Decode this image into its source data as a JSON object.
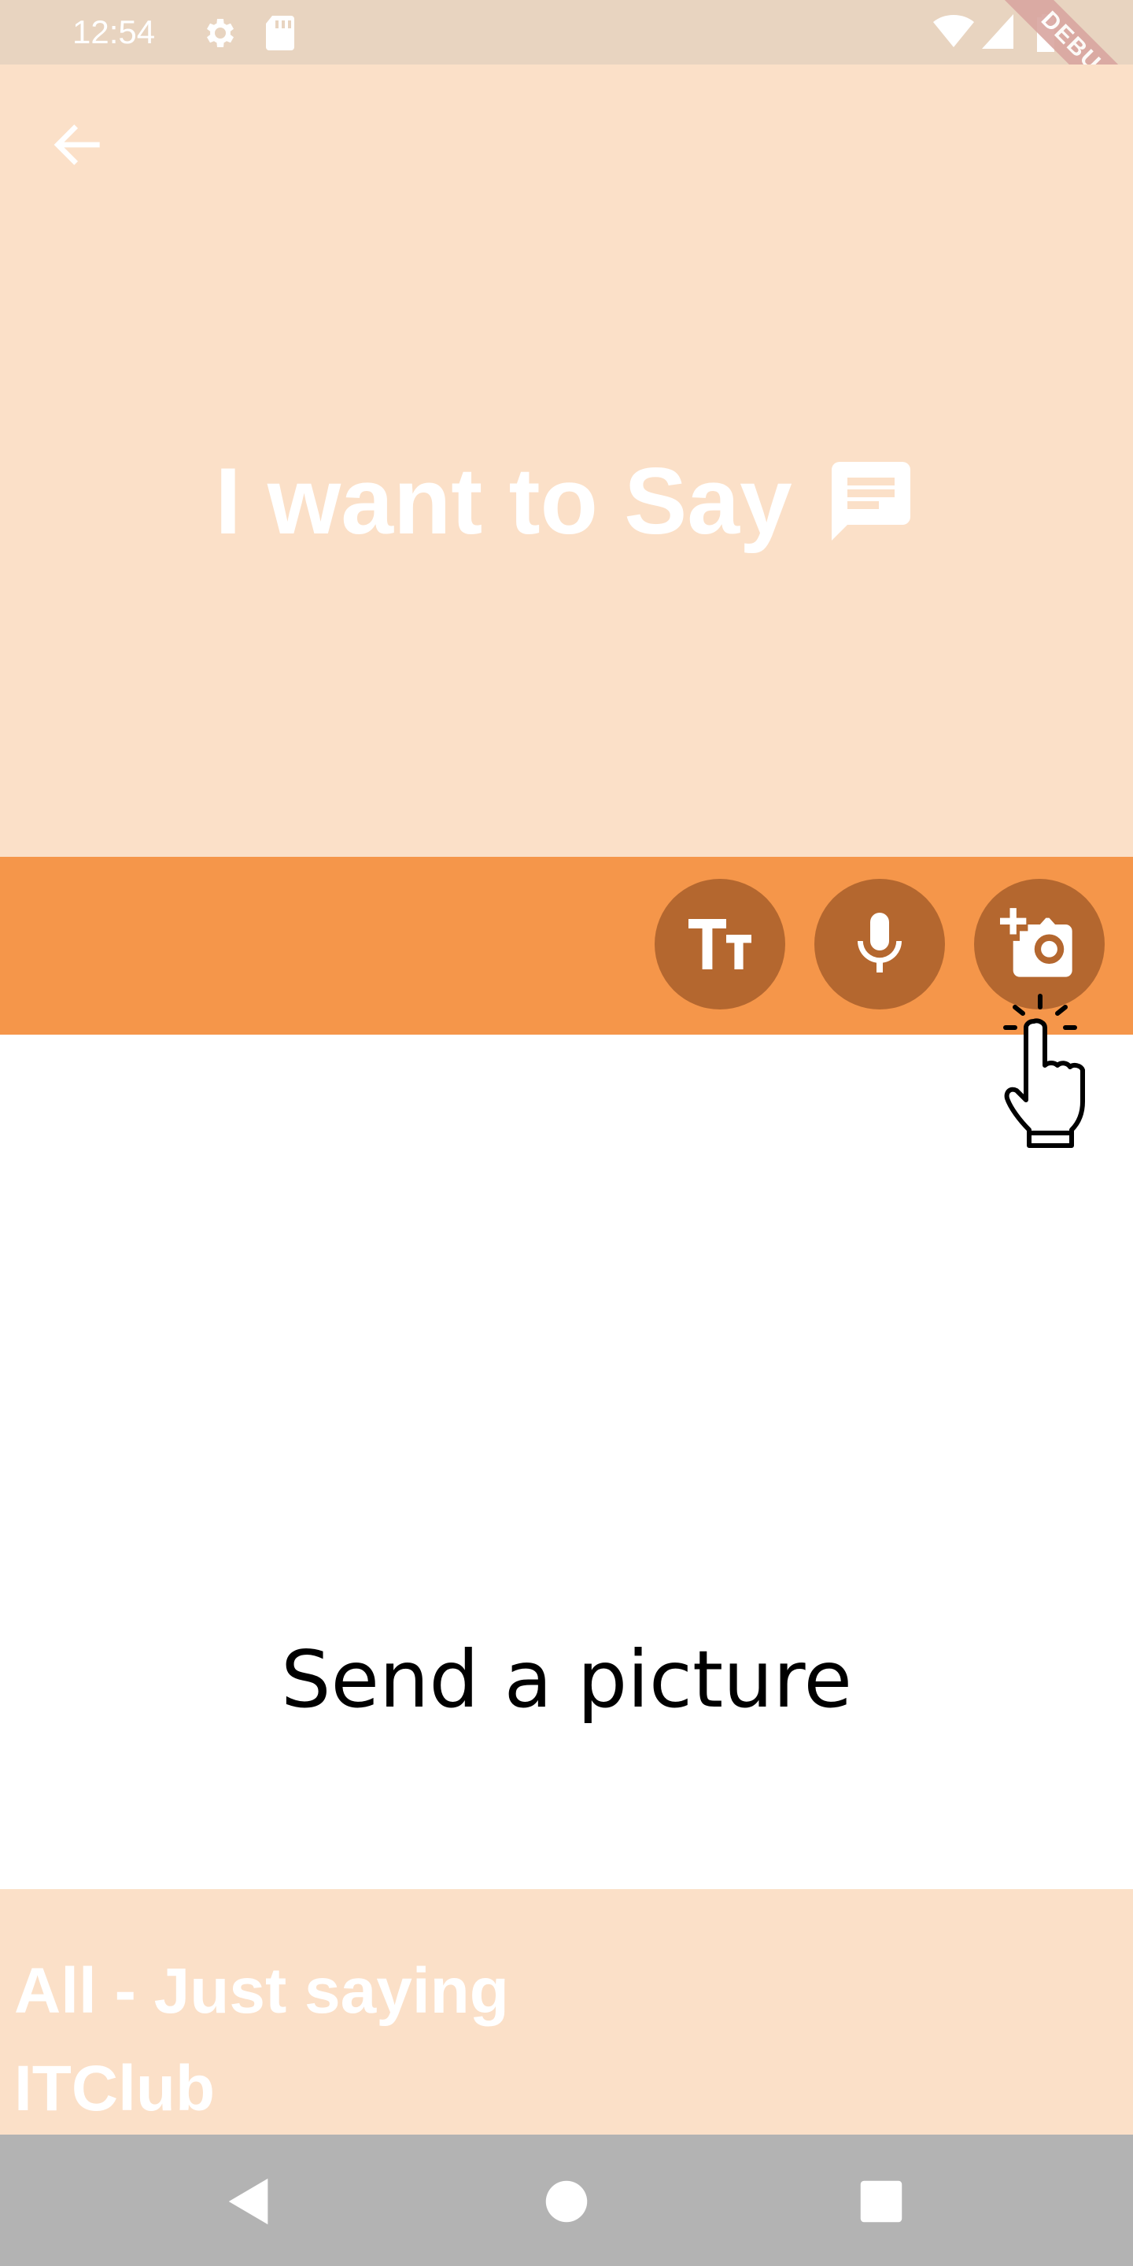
{
  "status_bar": {
    "time": "12:54",
    "icons": [
      "gear-icon",
      "sd-card-icon",
      "wifi-icon",
      "signal-icon",
      "battery-icon"
    ],
    "debug_label": "DEBUG"
  },
  "header": {
    "title": "I want to Say",
    "title_icon": "message-icon",
    "back_icon": "arrow-back-icon",
    "background": "#fbe0c8"
  },
  "toolbar": {
    "background": "#f5964a",
    "button_color": "#b4672f",
    "buttons": [
      {
        "name": "text",
        "icon": "text-size-icon"
      },
      {
        "name": "voice",
        "icon": "microphone-icon"
      },
      {
        "name": "picture",
        "icon": "add-camera-icon"
      }
    ]
  },
  "content": {
    "label": "Send a picture"
  },
  "footer": {
    "line1": "All - Just saying",
    "line2": "ITClub"
  },
  "nav_bar": {
    "buttons": [
      "back-triangle-icon",
      "home-circle-icon",
      "recents-square-icon"
    ]
  }
}
